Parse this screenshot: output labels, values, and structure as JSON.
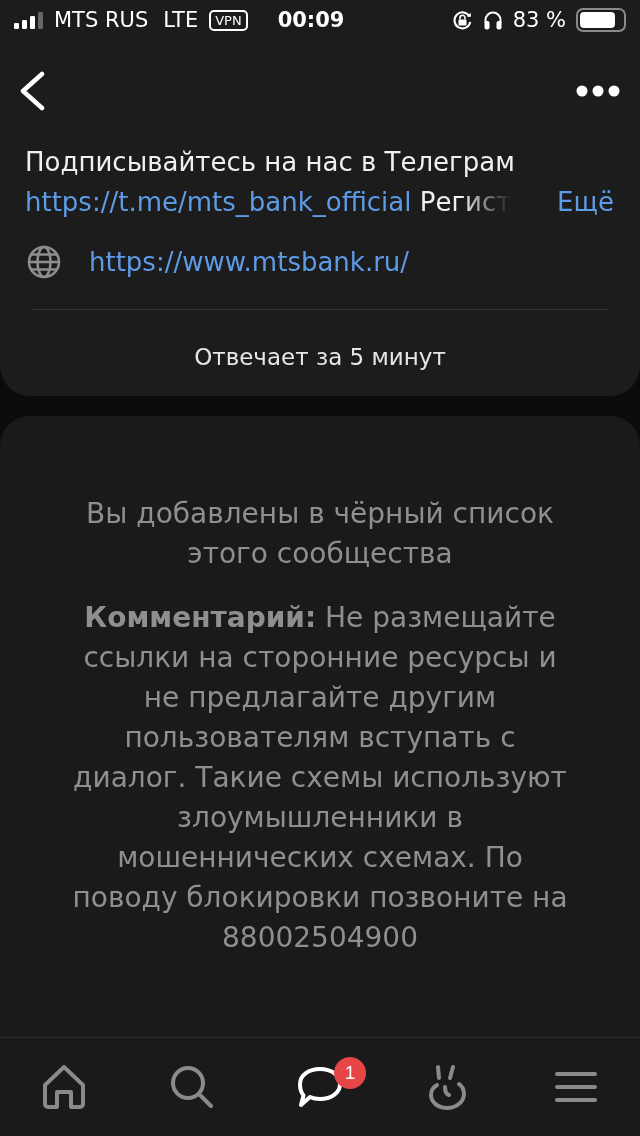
{
  "status_bar": {
    "carrier": "MTS RUS",
    "network": "LTE",
    "vpn": "VPN",
    "time": "00:09",
    "battery_percent": "83 %",
    "battery": {
      "level": 0.83
    }
  },
  "description": {
    "text": "Подписывайтесь на нас в Телеграм",
    "link": "https://t.me/mts_bank_official",
    "continuation": "Регист",
    "more": "Ещё"
  },
  "website": {
    "url": "https://www.mtsbank.ru/"
  },
  "response_time": "Отвечает за 5 минут",
  "blacklist_notice": {
    "title": "Вы добавлены в чёрный список этого сообщества",
    "comment": "**Комментарий:** Не размещайте ссылки на сторонние ресурсы и не предлагайте другим пользователям вступать с диалог. Такие схемы используют злоумышленники в мошеннических схемах. По поводу блокировки позвоните на 88002504900"
  },
  "tab_bar": {
    "tabs": [
      {
        "kind": "home",
        "selected": false
      },
      {
        "kind": "search",
        "selected": false
      },
      {
        "kind": "messages",
        "selected": true,
        "badge": "1"
      },
      {
        "kind": "clips",
        "selected": false
      },
      {
        "kind": "menu",
        "selected": false
      }
    ]
  }
}
